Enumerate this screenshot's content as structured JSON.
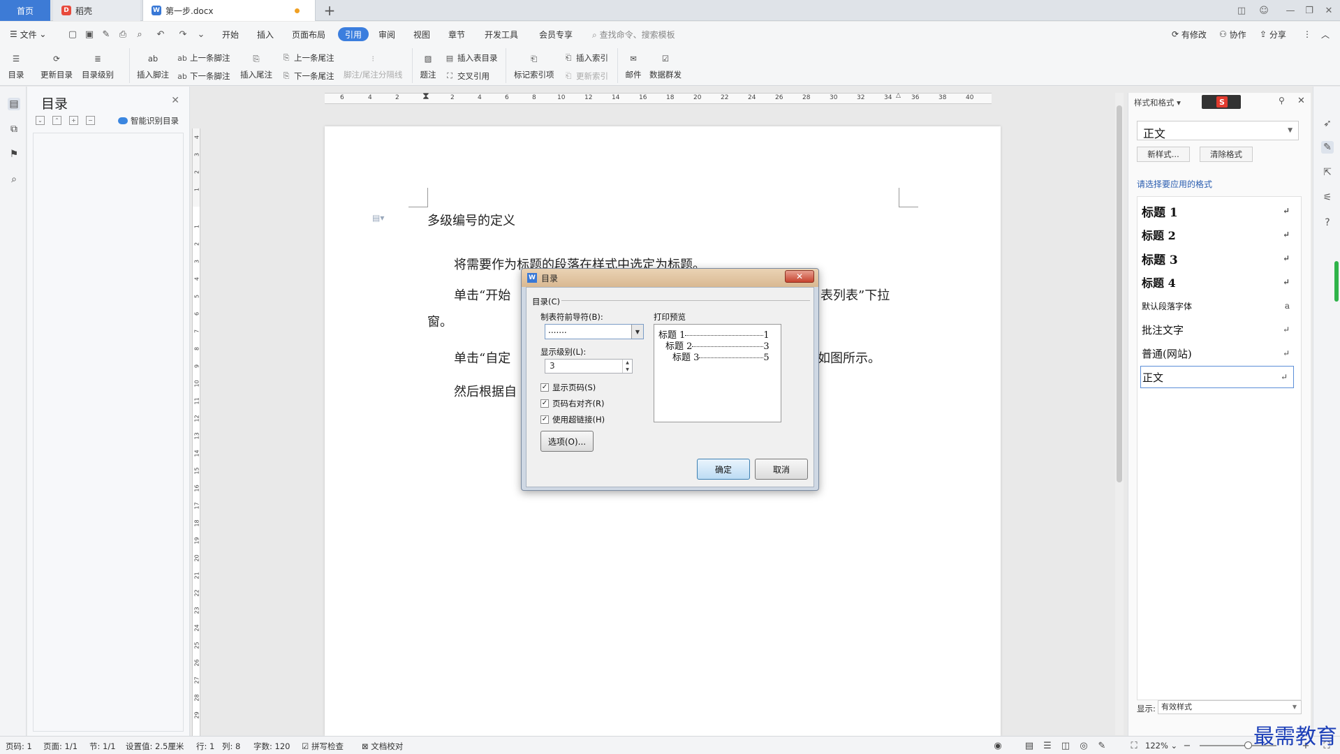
{
  "tabs": {
    "home": "首页",
    "daoke": "稻壳",
    "doc": "第一步.docx"
  },
  "menu": {
    "file": "文件",
    "items": [
      "开始",
      "插入",
      "页面布局",
      "引用",
      "审阅",
      "视图",
      "章节",
      "开发工具",
      "会员专享"
    ],
    "search": "查找命令、搜索模板",
    "modified": "有修改",
    "collab": "协作",
    "share": "分享"
  },
  "ribbon": {
    "toc": "目录",
    "update_toc": "更新目录",
    "toc_level": "目录级别",
    "insert_footnote": "插入脚注",
    "prev_footnote": "上一条脚注",
    "next_footnote": "下一条脚注",
    "insert_endnote": "插入尾注",
    "prev_endnote": "上一条尾注",
    "next_endnote": "下一条尾注",
    "note_separator": "脚注/尾注分隔线",
    "caption": "题注",
    "insert_table_toc": "插入表目录",
    "cross_ref": "交叉引用",
    "mark_index": "标记索引项",
    "insert_index": "插入索引",
    "update_index": "更新索引",
    "mail": "邮件",
    "mail_merge": "数据群发"
  },
  "toc_panel": {
    "title": "目录",
    "smart": "智能识别目录"
  },
  "ruler": {
    "h": [
      "6",
      "4",
      "2",
      "2",
      "4",
      "6",
      "8",
      "10",
      "12",
      "14",
      "16",
      "18",
      "20",
      "22",
      "24",
      "26",
      "28",
      "30",
      "32",
      "34",
      "36",
      "38",
      "40"
    ],
    "v_top": [
      "4",
      "3",
      "2",
      "1"
    ],
    "v": [
      "1",
      "2",
      "3",
      "4",
      "5",
      "6",
      "7",
      "8",
      "9",
      "10",
      "11",
      "12",
      "13",
      "14",
      "15",
      "16",
      "17",
      "18",
      "19",
      "20",
      "21",
      "22",
      "23",
      "24",
      "25",
      "26",
      "27",
      "28",
      "29"
    ]
  },
  "document": {
    "heading": "多级编号的定义",
    "p1": "将需要作为标题的段落在样式中选定为标题。",
    "p2a": "单击“开始",
    "p2b": "“下拉",
    "p2b_full": "表列表”下拉",
    "p2c": "窗。",
    "p3a": "单击“自定",
    "p3b": "如图所示。",
    "p4a": "然后根据自"
  },
  "dialog": {
    "title": "目录",
    "group": "目录(C)",
    "leader_label": "制表符前导符(B):",
    "leader_value": ".......",
    "level_label": "显示级别(L):",
    "level_value": "3",
    "show_page": "显示页码(S)",
    "align_right": "页码右对齐(R)",
    "hyperlink": "使用超链接(H)",
    "options": "选项(O)...",
    "preview_label": "打印预览",
    "preview": [
      {
        "text": "标题 1",
        "page": "1"
      },
      {
        "text": "标题 2",
        "page": "3"
      },
      {
        "text": "标题 3",
        "page": "5"
      }
    ],
    "ok": "确定",
    "cancel": "取消"
  },
  "style_panel": {
    "title": "样式和格式",
    "current": "正文",
    "new_style": "新样式...",
    "clear_format": "清除格式",
    "apply_label": "请选择要应用的格式",
    "styles": [
      "标题 1",
      "标题 2",
      "标题 3",
      "标题 4",
      "默认段落字体",
      "批注文字",
      "普通(网站)",
      "正文"
    ],
    "show_label": "显示:",
    "show_value": "有效样式"
  },
  "status": {
    "page": "页码: 1",
    "pages": "页面: 1/1",
    "section": "节: 1/1",
    "setting": "设置值: 2.5厘米",
    "row": "行: 1",
    "col": "列: 8",
    "words": "字数: 120",
    "spell": "拼写检查",
    "proof": "文档校对",
    "zoom": "122%"
  },
  "watermark": "最需教育",
  "colors": {
    "accent": "#3b7ede",
    "tab_active": "#3d7bd6"
  }
}
